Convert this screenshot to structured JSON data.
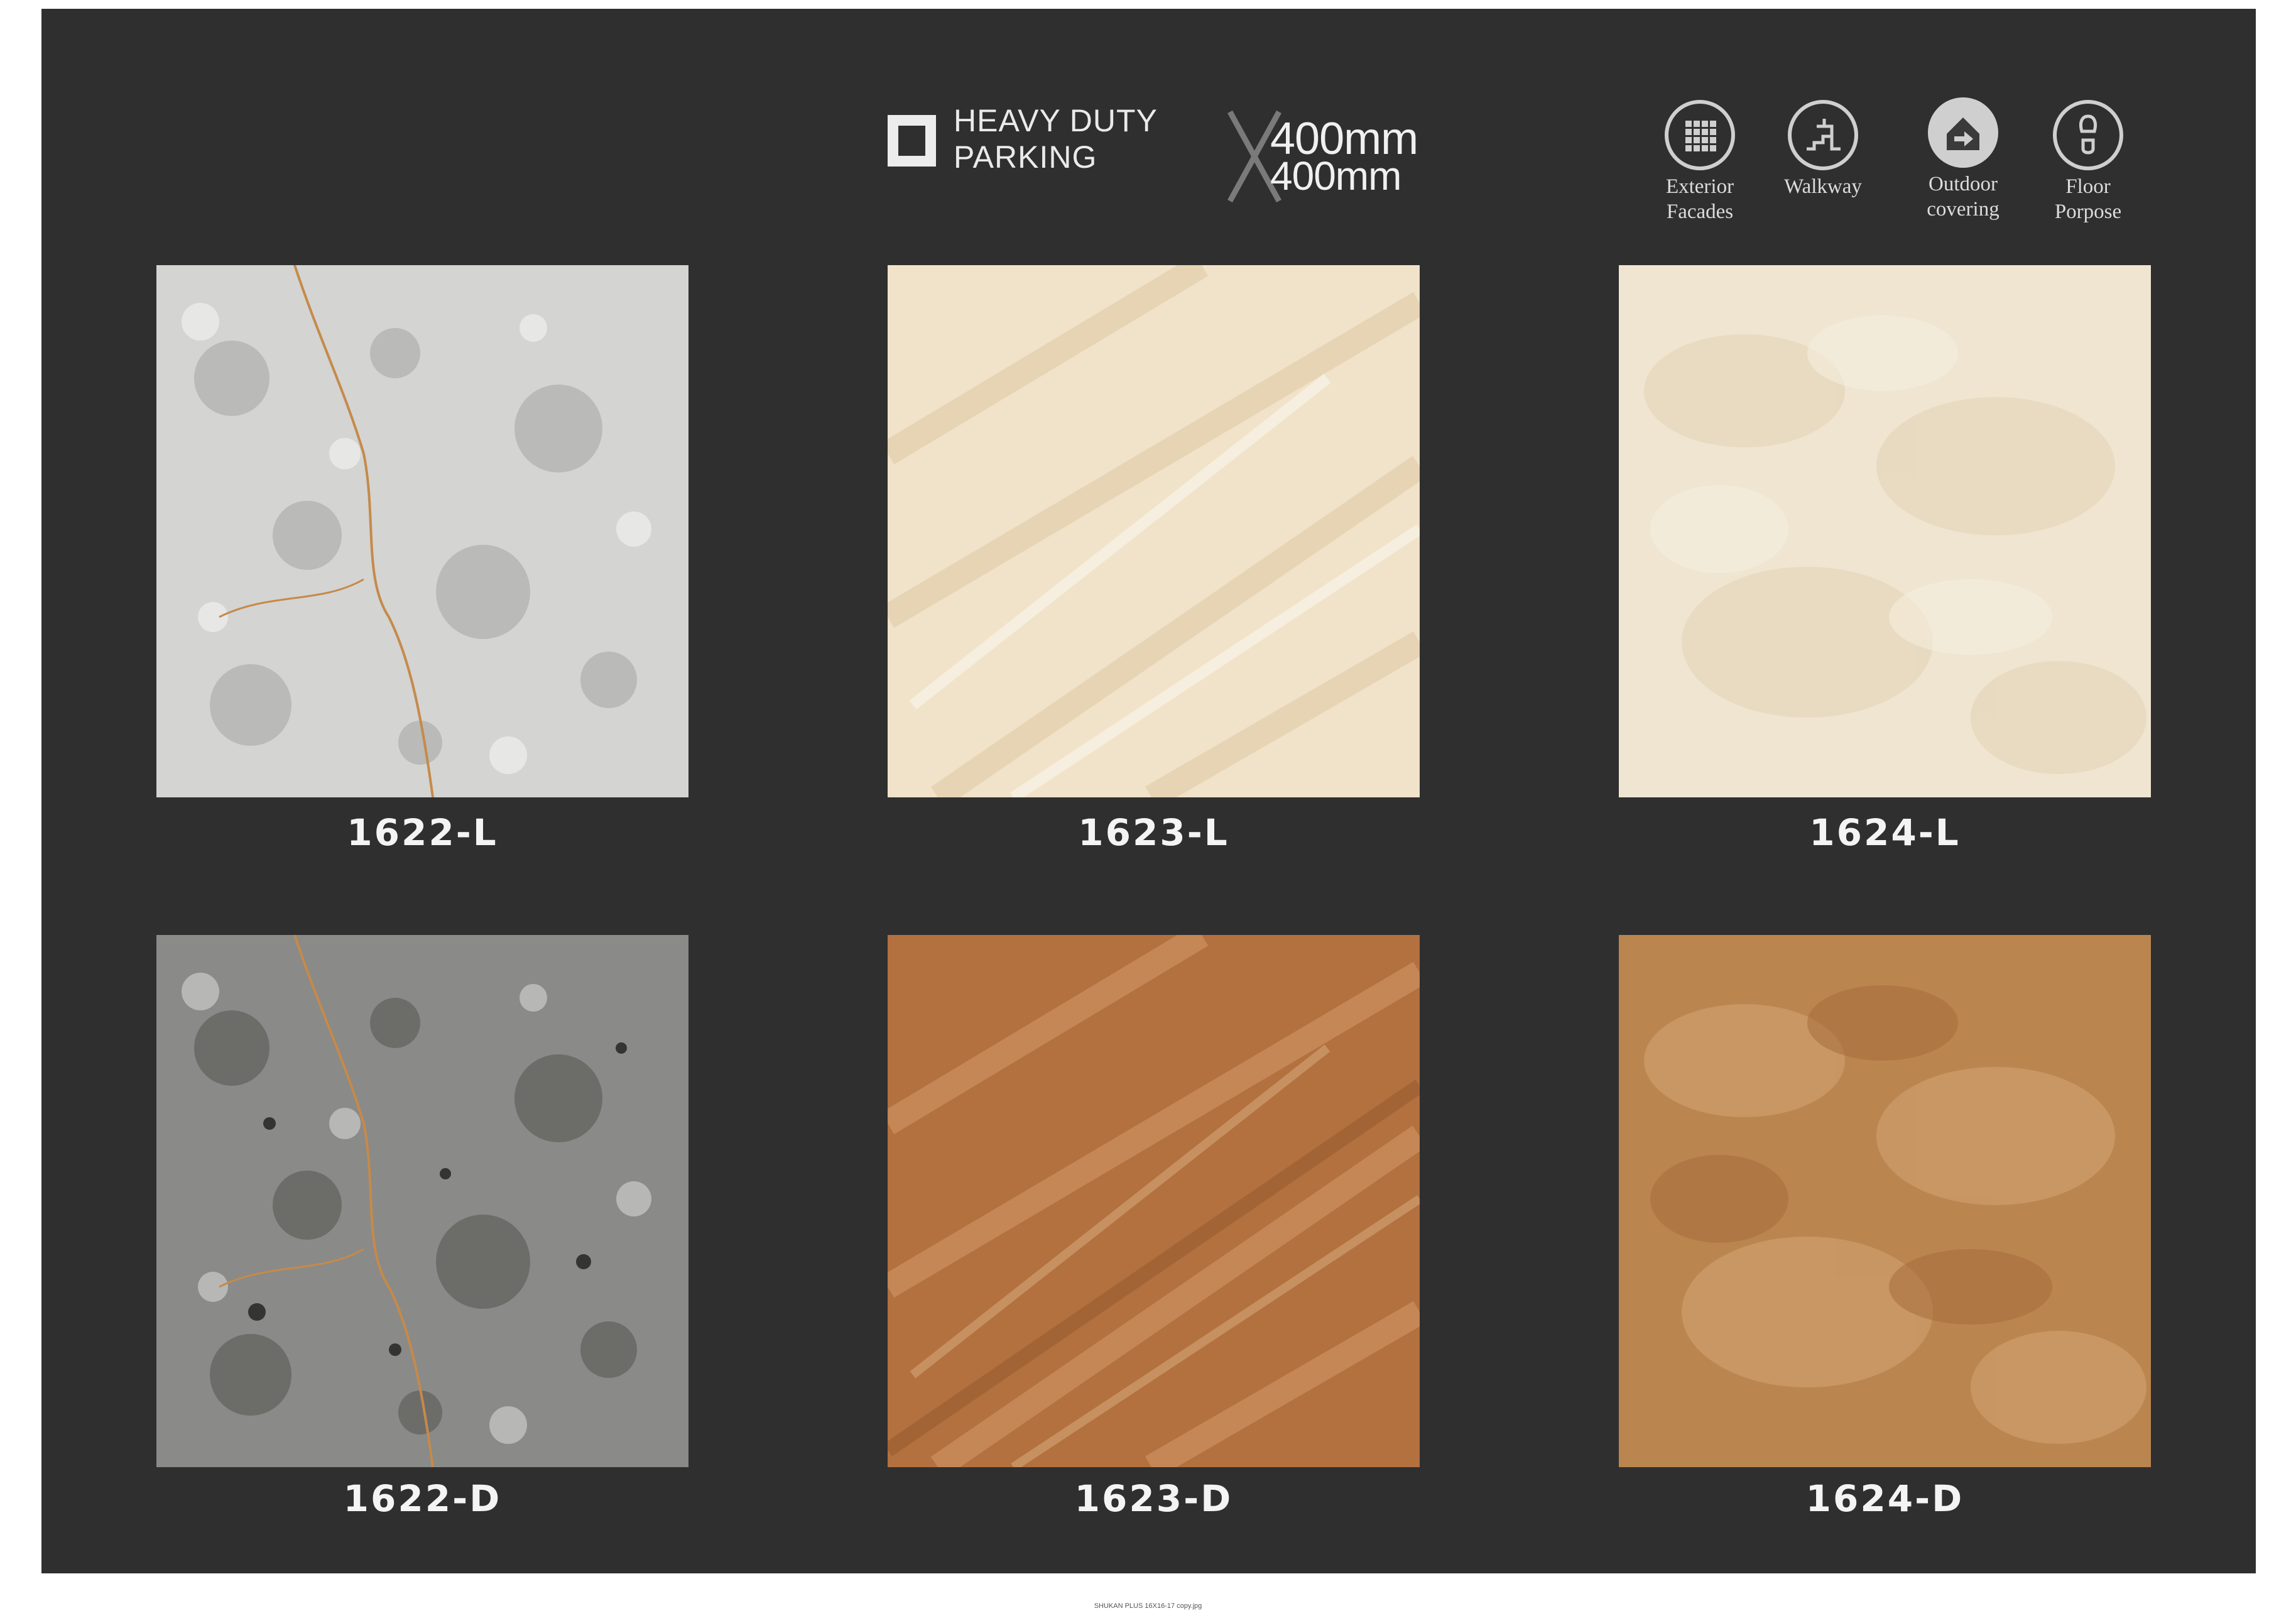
{
  "header": {
    "rating_line_1": "HEAVY DUTY",
    "rating_line_2": "PARKING",
    "size_line_1": "400mm",
    "size_line_2": "400mm"
  },
  "applications": [
    {
      "label": "Exterior\nFacades",
      "icon": "grid-facade-icon"
    },
    {
      "label": "Walkway",
      "icon": "walkway-icon"
    },
    {
      "label": "Outdoor\ncovering",
      "icon": "outdoor-covering-icon"
    },
    {
      "label": "Floor\nPorpose",
      "icon": "footprint-icon"
    }
  ],
  "tiles": [
    {
      "code": "1622-L",
      "base": "#d4d4d2",
      "accent": "#a9a9a7",
      "vein": "#c58a4a"
    },
    {
      "code": "1623-L",
      "base": "#f1e3c9",
      "accent": "#e0cba8",
      "vein": "#d9c29d"
    },
    {
      "code": "1624-L",
      "base": "#efe5d1",
      "accent": "#e2d3b6",
      "vein": "#d8c7a6"
    },
    {
      "code": "1622-D",
      "base": "#8a8a88",
      "accent": "#5f5f5d",
      "vein": "#c58a4a"
    },
    {
      "code": "1623-D",
      "base": "#b3713f",
      "accent": "#d39a68",
      "vein": "#dcb083"
    },
    {
      "code": "1624-D",
      "base": "#bb854f",
      "accent": "#d3a574",
      "vein": "#a36a39"
    }
  ],
  "footer_note": "SHUKAN PLUS 16X16-17 copy.jpg"
}
